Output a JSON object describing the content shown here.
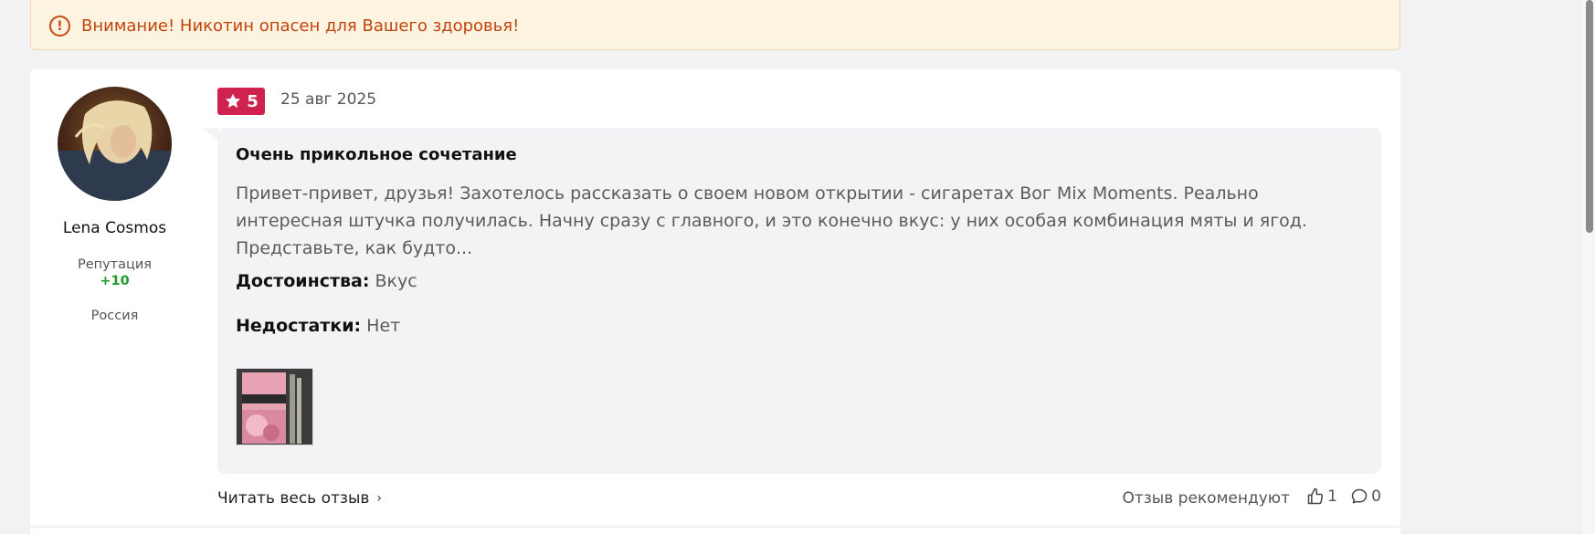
{
  "warning": {
    "icon": "exclamation-circle-icon",
    "text": "Внимание! Никотин опасен для Вашего здоровья!"
  },
  "author": {
    "name": "Lena Cosmos",
    "reputation_label": "Репутация",
    "reputation_value": "+10",
    "country": "Россия"
  },
  "review": {
    "rating": "5",
    "date": "25 авг 2025",
    "title": "Очень прикольное сочетание",
    "text": "Привет-привет, друзья! Захотелось рассказать о своем новом открытии - сигаретах Вог Mix Moments. Реально интересная штучка получилась. Начну сразу с главного, и это конечно вкус: у них особая комбинация мяты и ягод. Представьте, как будто...",
    "pros_label": "Достоинства:",
    "pros_value": "Вкус",
    "cons_label": "Недостатки:",
    "cons_value": "Нет"
  },
  "footer": {
    "read_more": "Читать весь отзыв",
    "recommend_label": "Отзыв рекомендуют",
    "likes_count": "1",
    "comments_count": "0"
  },
  "colors": {
    "rating_badge": "#d0224e",
    "warning_text": "#c0440d",
    "reputation_positive": "#1f9d2b"
  }
}
